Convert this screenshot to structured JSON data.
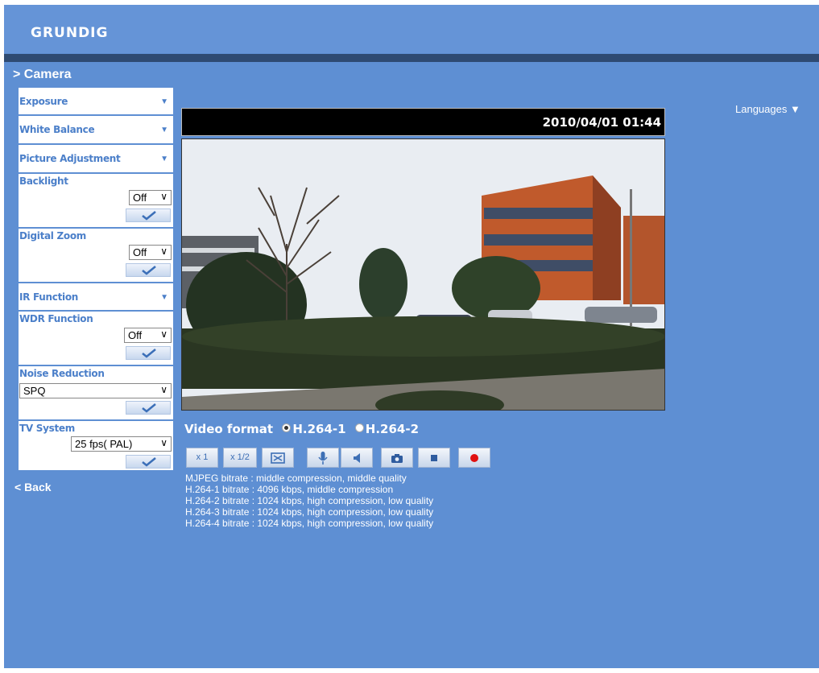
{
  "header": {
    "brand": "GRUNDIG"
  },
  "sidebar": {
    "section_title": "> Camera",
    "exposure": "Exposure",
    "white_balance": "White Balance",
    "picture_adjustment": "Picture Adjustment",
    "backlight": {
      "label": "Backlight",
      "value": "Off"
    },
    "digital_zoom": {
      "label": "Digital Zoom",
      "value": "Off"
    },
    "ir_function": "IR Function",
    "wdr_function": {
      "label": "WDR Function",
      "value": "Off"
    },
    "noise_reduction": {
      "label": "Noise Reduction",
      "value": "SPQ"
    },
    "tv_system": {
      "label": "TV System",
      "value": "25 fps( PAL)"
    },
    "back": "< Back"
  },
  "languages": "Languages ▼",
  "viewer": {
    "timestamp": "2010/04/01 01:44",
    "video_format_label": "Video format",
    "format_options": [
      "H.264-1",
      "H.264-2"
    ],
    "selected_format": "H.264-1"
  },
  "controls": {
    "zoom1": "x 1",
    "zoom_half": "x 1/2"
  },
  "info_lines": [
    "MJPEG bitrate : middle compression, middle quality",
    "H.264-1 bitrate : 4096 kbps, middle compression",
    "H.264-2 bitrate : 1024 kbps, high compression, low quality",
    "H.264-3 bitrate : 1024 kbps, high compression, low quality",
    "H.264-4 bitrate : 1024 kbps, high compression, low quality"
  ],
  "colors": {
    "page_bg": "#5e8fd3",
    "header_rule": "#2e4a72",
    "record_red": "#e01010"
  }
}
